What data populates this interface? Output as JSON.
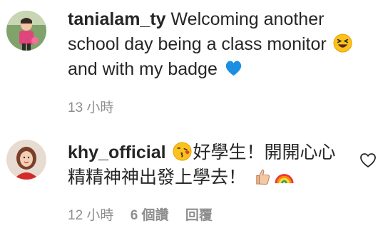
{
  "comments": [
    {
      "username": "tanialam_ty",
      "text_part1": "Welcoming another school day being a class monitor",
      "emoji1": "squinting-face-emoji",
      "text_part2": "and with my badge",
      "emoji2": "blue-heart-emoji",
      "time": "13 小時"
    },
    {
      "username": "khy_official",
      "emoji1": "face-blowing-kiss-emoji",
      "text_line1": "好學生！開開心心",
      "text_line2": "精精神神出發上學去！",
      "emoji2": "thumbs-up-emoji",
      "emoji3": "rainbow-emoji",
      "time": "12 小時",
      "likes": "6 個讚",
      "reply_label": "回覆"
    }
  ],
  "colors": {
    "text": "#262626",
    "meta": "#8e8e8e",
    "blue_heart": "#1da1f2"
  }
}
